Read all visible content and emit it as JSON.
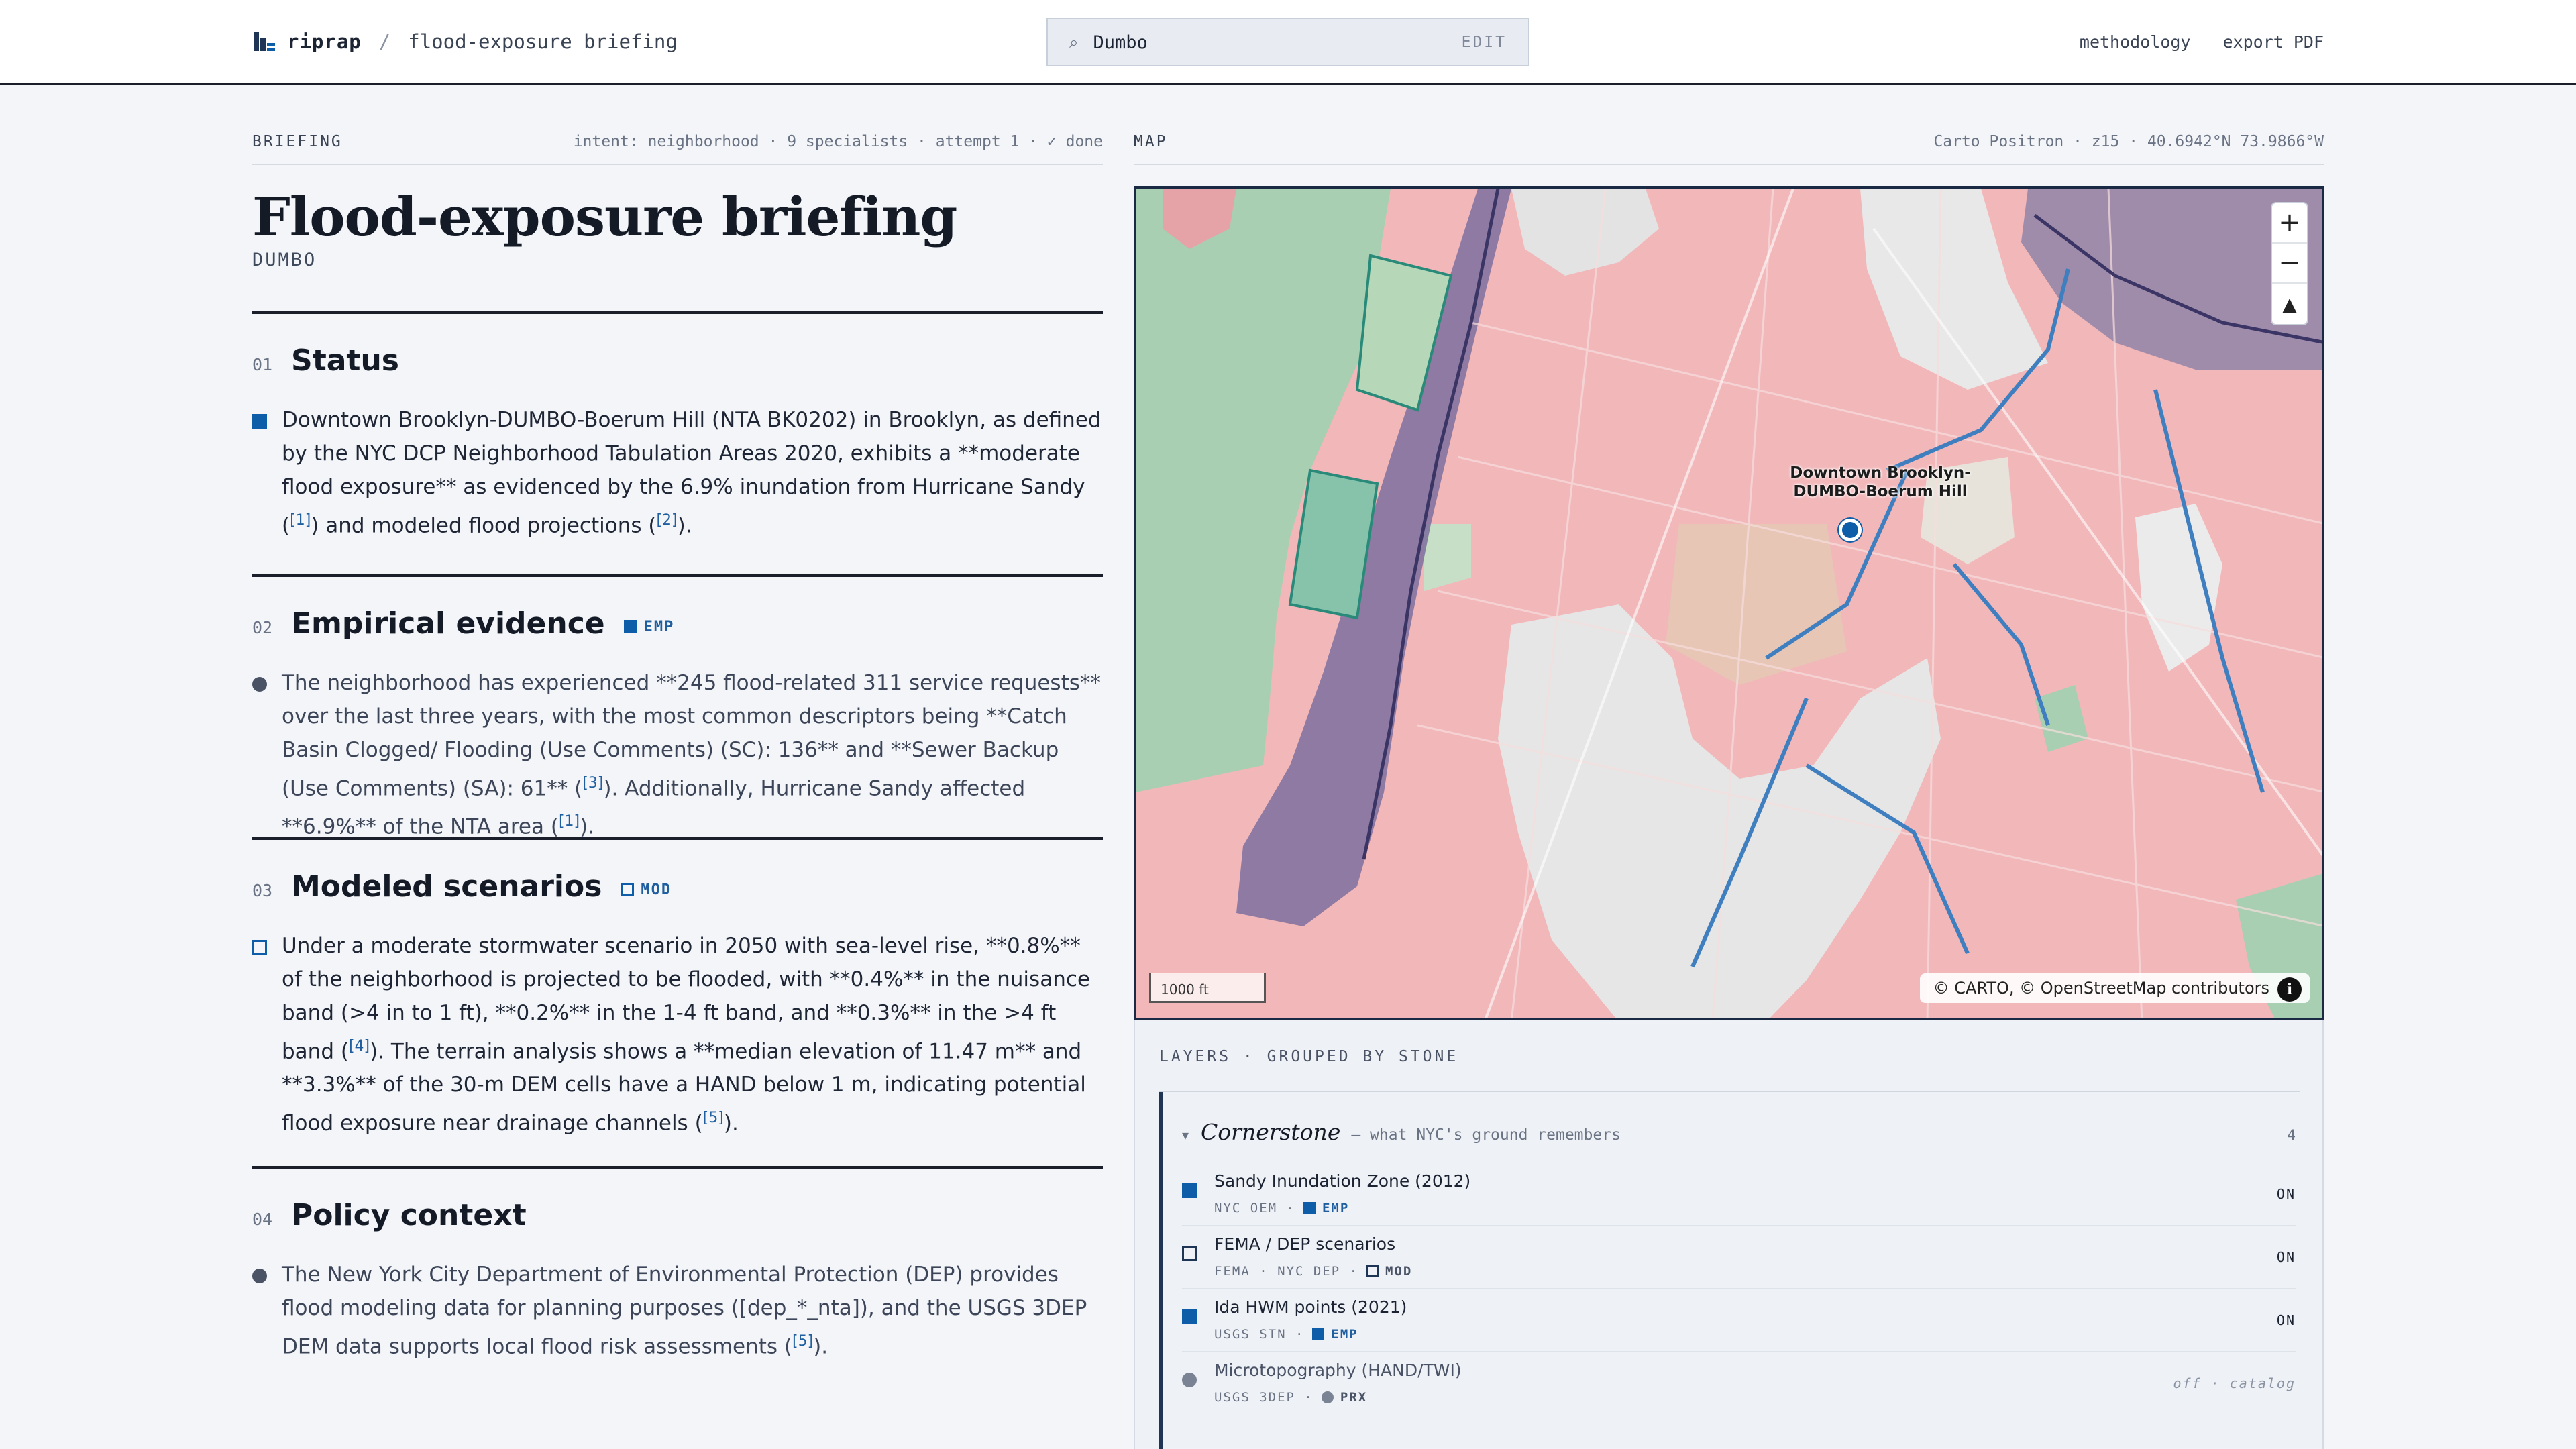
{
  "header": {
    "brand": "riprap",
    "separator": "/",
    "page": "flood-exposure briefing",
    "search_value": "Dumbo",
    "search_edit": "EDIT",
    "links": [
      "methodology",
      "export PDF"
    ]
  },
  "briefing": {
    "label": "BRIEFING",
    "meta": "intent: neighborhood · 9 specialists · attempt 1 · ✓ done",
    "title": "Flood-exposure briefing",
    "subtitle": "DUMBO",
    "sections": [
      {
        "num": "01",
        "title": "Status",
        "tag": "",
        "bullet": "square",
        "parts": [
          {
            "t": "Downtown Brooklyn-DUMBO-Boerum Hill (NTA BK0202) in Brooklyn, as defined by the NYC DCP Neighborhood Tabulation Areas 2020, exhibits a **moderate flood exposure** as evidenced by the 6.9% inundation from Hurricane Sandy ("
          },
          {
            "c": "[1]"
          },
          {
            "t": ") and modeled flood projections ("
          },
          {
            "c": "[2]"
          },
          {
            "t": ")."
          }
        ]
      },
      {
        "num": "02",
        "title": "Empirical evidence",
        "tag": "EMP",
        "bullet": "dot",
        "parts": [
          {
            "t": "The neighborhood has experienced **245 flood-related 311 service requests** over the last three years, with the most common descriptors being **Catch Basin Clogged/ Flooding (Use Comments) (SC): 136** and **Sewer Backup (Use Comments) (SA): 61** ("
          },
          {
            "c": "[3]"
          },
          {
            "t": "). Additionally, Hurricane Sandy affected **6.9%** of the NTA area ("
          },
          {
            "c": "[1]"
          },
          {
            "t": ")."
          }
        ]
      },
      {
        "num": "03",
        "title": "Modeled scenarios",
        "tag": "MOD",
        "bullet": "hollow",
        "parts": [
          {
            "t": "Under a moderate stormwater scenario in 2050 with sea-level rise, **0.8%** of the neighborhood is projected to be flooded, with **0.4%** in the nuisance band (>4 in to 1 ft), **0.2%** in the 1-4 ft band, and **0.3%** in the >4 ft band ("
          },
          {
            "c": "[4]"
          },
          {
            "t": "). The terrain analysis shows a **median elevation of 11.47 m** and **3.3%** of the 30-m DEM cells have a HAND below 1 m, indicating potential flood exposure near drainage channels ("
          },
          {
            "c": "[5]"
          },
          {
            "t": ")."
          }
        ]
      },
      {
        "num": "04",
        "title": "Policy context",
        "tag": "",
        "bullet": "dot",
        "parts": [
          {
            "t": "The New York City Department of Environmental Protection (DEP) provides flood modeling data for planning purposes ([dep_*_nta]), and the USGS 3DEP DEM data supports local flood risk assessments ("
          },
          {
            "c": "[5]"
          },
          {
            "t": ")."
          }
        ]
      }
    ]
  },
  "map": {
    "label": "MAP",
    "meta": "Carto Positron · z15 · 40.6942°N 73.9866°W",
    "zoom_in": "+",
    "zoom_out": "−",
    "compass": "▲",
    "pin_label_line1": "Downtown Brooklyn-",
    "pin_label_line2": "DUMBO-Boerum Hill",
    "scale": "1000 ft",
    "attribution": "© CARTO, © OpenStreetMap contributors",
    "info": "i"
  },
  "layers": {
    "heading": "LAYERS · GROUPED BY STONE",
    "group": {
      "chevron": "▾",
      "name": "Cornerstone",
      "desc": "— what NYC's ground remembers",
      "count": "4"
    },
    "rows": [
      {
        "name": "Sandy Inundation Zone (2012)",
        "source": "NYC OEM ·",
        "badge": "EMP",
        "kind": "square",
        "state": "ON"
      },
      {
        "name": "FEMA / DEP scenarios",
        "source": "FEMA · NYC DEP ·",
        "badge": "MOD",
        "kind": "hollow",
        "state": "ON"
      },
      {
        "name": "Ida HWM points (2021)",
        "source": "USGS STN ·",
        "badge": "EMP",
        "kind": "square",
        "state": "ON"
      },
      {
        "name": "Microtopography (HAND/TWI)",
        "source": "USGS 3DEP ·",
        "badge": "PRX",
        "kind": "dot",
        "state": "off · catalog"
      }
    ]
  },
  "colors": {
    "accent": "#0d5da8",
    "flood_pink": "#f0b3b6",
    "water_green": "#a9cfb2",
    "hwm_blue": "#3f7fbf",
    "sandy_purple": "#5a4f86"
  }
}
